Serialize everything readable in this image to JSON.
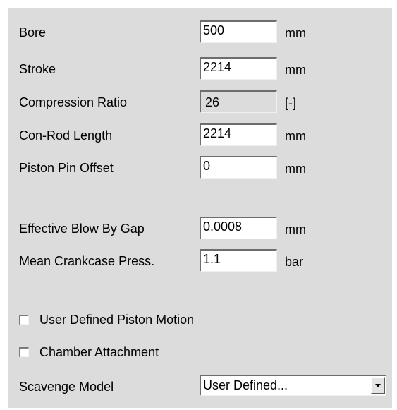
{
  "fields": {
    "bore": {
      "label": "Bore",
      "value": "500",
      "unit": "mm"
    },
    "stroke": {
      "label": "Stroke",
      "value": "2214",
      "unit": "mm"
    },
    "compression_ratio": {
      "label": "Compression Ratio",
      "value": "26",
      "unit": "[-]"
    },
    "con_rod_length": {
      "label": "Con-Rod Length",
      "value": "2214",
      "unit": "mm"
    },
    "piston_pin_offset": {
      "label": "Piston Pin Offset",
      "value": "0",
      "unit": "mm"
    },
    "blow_by_gap": {
      "label": "Effective Blow By Gap",
      "value": "0.0008",
      "unit": "mm"
    },
    "crankcase_press": {
      "label": "Mean Crankcase Press.",
      "value": "1.1",
      "unit": "bar"
    }
  },
  "checkboxes": {
    "user_defined_piston_motion": {
      "label": "User Defined Piston Motion",
      "checked": false
    },
    "chamber_attachment": {
      "label": "Chamber Attachment",
      "checked": false
    }
  },
  "scavenge": {
    "label": "Scavenge Model",
    "selected": "User Defined..."
  },
  "icons": {
    "dropdown": "chevron-down-icon"
  }
}
